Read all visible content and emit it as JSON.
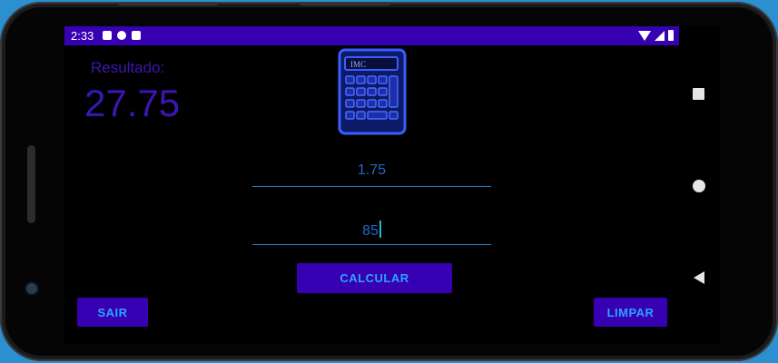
{
  "status_bar": {
    "time": "2:33",
    "left_icons": [
      "notification-a-icon",
      "play-protect-icon",
      "sd-card-icon"
    ],
    "right_icons": [
      "wifi-icon",
      "signal-icon",
      "battery-icon"
    ],
    "color": "#3700b3"
  },
  "result": {
    "label": "Resultado:",
    "value": "27.75"
  },
  "calculator_icon": {
    "display_text": "IMC"
  },
  "inputs": {
    "height_value": "1.75",
    "weight_value": "85"
  },
  "buttons": {
    "calcular": "CALCULAR",
    "sair": "SAIR",
    "limpar": "LIMPAR"
  },
  "nav_bar": {
    "icons": [
      "recents-icon",
      "home-icon",
      "back-icon"
    ]
  },
  "colors": {
    "accent": "#3700b3",
    "button_text": "#2aa4ff",
    "result_text": "#3a16b0",
    "input_text": "#1f6cc8",
    "background": "#000000"
  }
}
